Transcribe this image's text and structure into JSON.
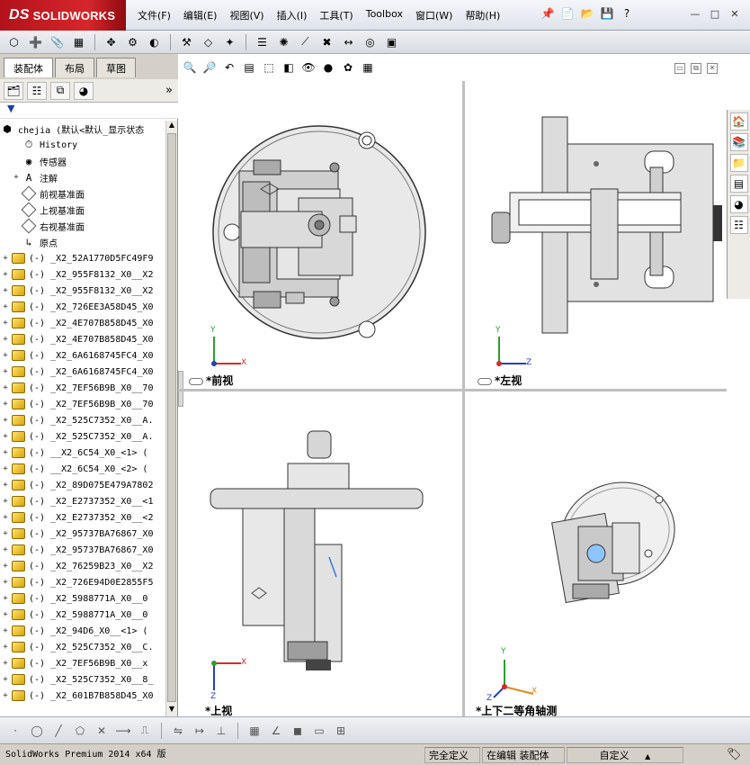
{
  "app": {
    "logo_prefix": "DS",
    "logo_text": "SOLIDWORKS"
  },
  "menu": [
    "文件(F)",
    "编辑(E)",
    "视图(V)",
    "插入(I)",
    "工具(T)",
    "Toolbox",
    "窗口(W)",
    "帮助(H)"
  ],
  "panel": {
    "tabs": [
      "装配体",
      "布局",
      "草图"
    ],
    "active_tab": "装配体"
  },
  "tree": {
    "root": "chejia  (默认<默认_显示状态",
    "items": [
      {
        "label": "History",
        "icon": "history-icon"
      },
      {
        "label": "传感器",
        "icon": "sensor-icon"
      },
      {
        "label": "注解",
        "icon": "annotation-icon",
        "expand": "+"
      },
      {
        "label": "前视基准面",
        "icon": "plane-icon"
      },
      {
        "label": "上视基准面",
        "icon": "plane-icon"
      },
      {
        "label": "右视基准面",
        "icon": "plane-icon"
      },
      {
        "label": "原点",
        "icon": "origin-icon"
      }
    ],
    "parts": [
      "(-) _X2_52A1770D5FC49F9",
      "(-) _X2_955F8132_X0__X2",
      "(-) _X2_955F8132_X0__X2",
      "(-) _X2_726EE3A58D45_X0",
      "(-) _X2_4E707B858D45_X0",
      "(-) _X2_4E707B858D45_X0",
      "(-) _X2_6A6168745FC4_X0",
      "(-) _X2_6A6168745FC4_X0",
      "(-) _X2_7EF56B9B_X0__70",
      "(-) _X2_7EF56B9B_X0__70",
      "(-) _X2_525C7352_X0__A.",
      "(-) _X2_525C7352_X0__A.",
      "(-) __X2_6C54_X0_<1> (",
      "(-) __X2_6C54_X0_<2> (",
      "(-) _X2_89D075E479A7802",
      "(-) _X2_E2737352_X0__<1",
      "(-) _X2_E2737352_X0__<2",
      "(-) _X2_95737BA76867_X0",
      "(-) _X2_95737BA76867_X0",
      "(-) _X2_76259B23_X0__X2",
      "(-) _X2_726E94D0E2855F5",
      "(-) _X2_5988771A_X0__0",
      "(-) _X2_5988771A_X0__0",
      "(-) _X2_94D6_X0__<1> (",
      "(-) _X2_525C7352_X0__C.",
      "(-) _X2_7EF56B9B_X0__x",
      "(-) _X2_525C7352_X0__8_",
      "(-) _X2_601B7B858D45_X0"
    ]
  },
  "viewports": {
    "front": "*前视",
    "left": "*左视",
    "top": "*上视",
    "iso": "*上下二等角轴测"
  },
  "axes": {
    "x": "X",
    "y": "Y",
    "z": "Z"
  },
  "status": {
    "app_name": "SolidWorks Premium 2014 x64 版",
    "definition": "完全定义",
    "mode": "在编辑 装配体",
    "custom": "自定义",
    "caret": "▲"
  }
}
